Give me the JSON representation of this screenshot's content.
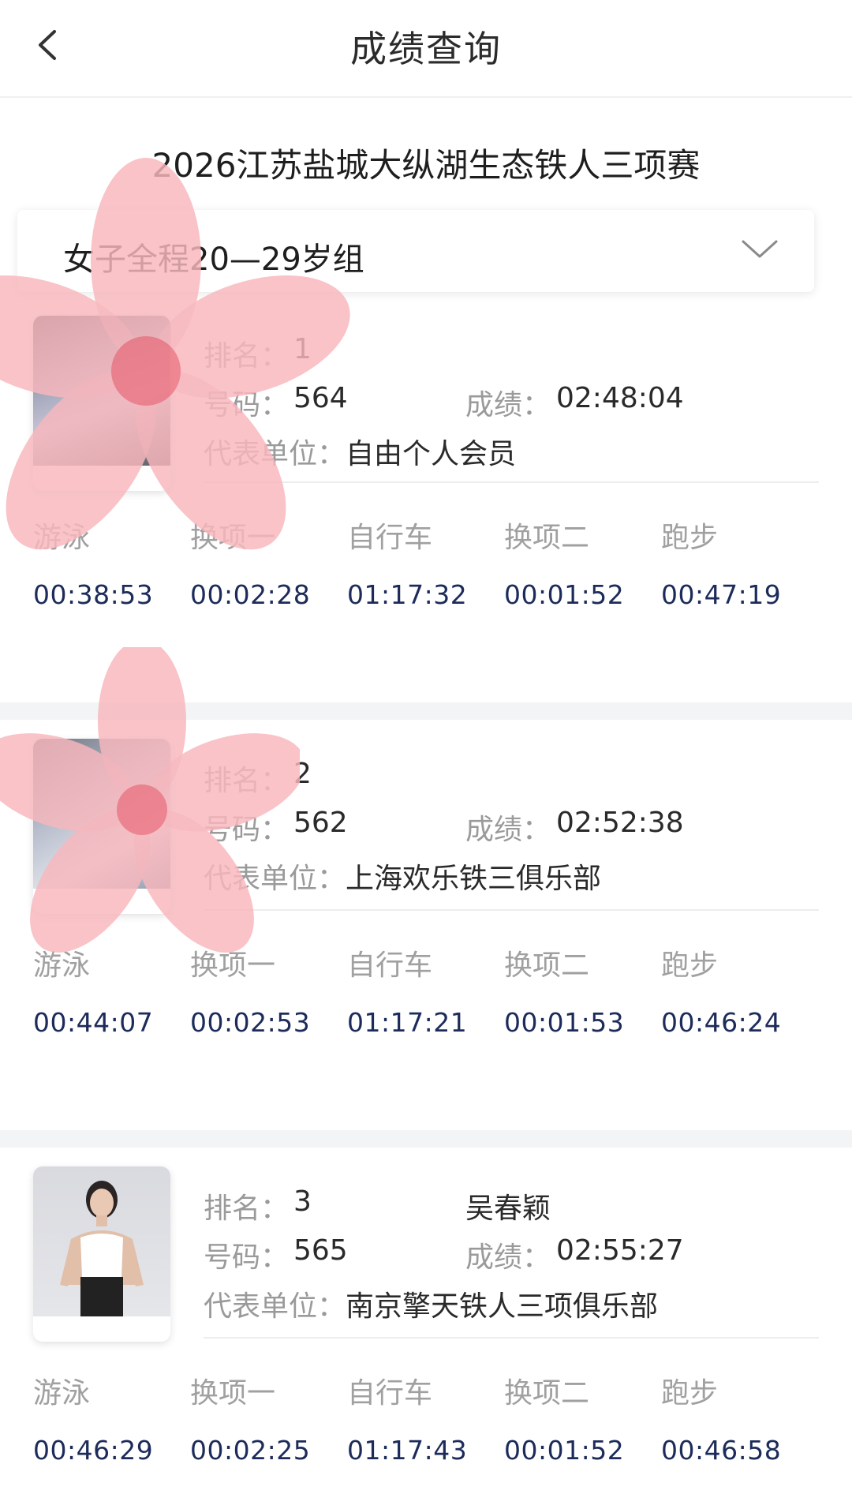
{
  "header": {
    "title": "成绩查询"
  },
  "event": {
    "title": "2026江苏盐城大纵湖生态铁人三项赛"
  },
  "group_select": {
    "selected": "女子全程20—29岁组"
  },
  "labels": {
    "rank": "排名：",
    "number": "号码：",
    "score": "成绩：",
    "unit": "代表单位："
  },
  "splits_headers": [
    "游泳",
    "换项一",
    "自行车",
    "换项二",
    "跑步"
  ],
  "results": [
    {
      "rank": "1",
      "name": "",
      "number": "564",
      "score": "02:48:04",
      "unit": "自由个人会员",
      "splits": [
        "00:38:53",
        "00:02:28",
        "01:17:32",
        "00:01:52",
        "00:47:19"
      ]
    },
    {
      "rank": "2",
      "name": "",
      "number": "562",
      "score": "02:52:38",
      "unit": "上海欢乐铁三俱乐部",
      "splits": [
        "00:44:07",
        "00:02:53",
        "01:17:21",
        "00:01:53",
        "00:46:24"
      ]
    },
    {
      "rank": "3",
      "name": "吴春颖",
      "number": "565",
      "score": "02:55:27",
      "unit": "南京擎天铁人三项俱乐部",
      "splits": [
        "00:46:29",
        "00:02:25",
        "01:17:43",
        "00:01:52",
        "00:46:58"
      ]
    }
  ],
  "colors": {
    "split_value": "#1c2b5a",
    "label_gray": "#9a9a9a",
    "sticker_petal": "#f7b7bd",
    "sticker_center": "#ee7d8a"
  }
}
